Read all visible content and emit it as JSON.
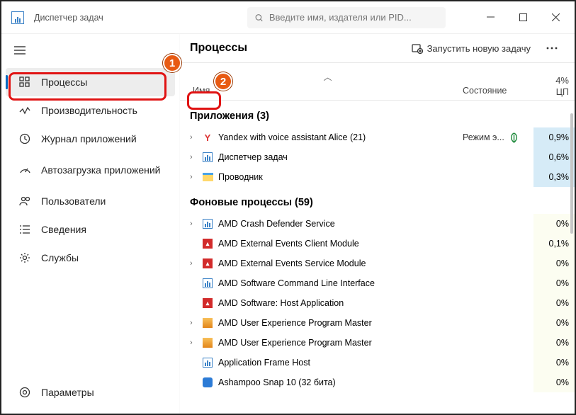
{
  "app": {
    "title": "Диспетчер задач"
  },
  "search": {
    "placeholder": "Введите имя, издателя или PID..."
  },
  "sidebar": {
    "items": [
      {
        "label": "Процессы"
      },
      {
        "label": "Производительность"
      },
      {
        "label": "Журнал приложений"
      },
      {
        "label": "Автозагрузка приложений"
      },
      {
        "label": "Пользователи"
      },
      {
        "label": "Сведения"
      },
      {
        "label": "Службы"
      }
    ],
    "settings": "Параметры"
  },
  "main": {
    "title": "Процессы",
    "run_task": "Запустить новую задачу",
    "columns": {
      "name": "Имя",
      "state": "Состояние",
      "cpu_pct": "4%",
      "cpu_label": "ЦП"
    },
    "groups": {
      "apps": {
        "title": "Приложения (3)",
        "rows": [
          {
            "name": "Yandex with voice assistant Alice (21)",
            "state": "Режим э...",
            "cpu": "0,9%",
            "icon": "y"
          },
          {
            "name": "Диспетчер задач",
            "state": "",
            "cpu": "0,6%",
            "icon": "tm"
          },
          {
            "name": "Проводник",
            "state": "",
            "cpu": "0,3%",
            "icon": "folder"
          }
        ]
      },
      "bg": {
        "title": "Фоновые процессы (59)",
        "rows": [
          {
            "name": "AMD Crash Defender Service",
            "cpu": "0%",
            "icon": "amd-b",
            "exp": true
          },
          {
            "name": "AMD External Events Client Module",
            "cpu": "0,1%",
            "icon": "amd-r"
          },
          {
            "name": "AMD External Events Service Module",
            "cpu": "0%",
            "icon": "amd-r",
            "exp": true
          },
          {
            "name": "AMD Software Command Line Interface",
            "cpu": "0%",
            "icon": "amd-b"
          },
          {
            "name": "AMD Software: Host Application",
            "cpu": "0%",
            "icon": "amd-r"
          },
          {
            "name": "AMD User Experience Program Master",
            "cpu": "0%",
            "icon": "pkg",
            "exp": true
          },
          {
            "name": "AMD User Experience Program Master",
            "cpu": "0%",
            "icon": "pkg",
            "exp": true
          },
          {
            "name": "Application Frame Host",
            "cpu": "0%",
            "icon": "amd-b"
          },
          {
            "name": "Ashampoo Snap 10 (32 бита)",
            "cpu": "0%",
            "icon": "ash"
          }
        ]
      }
    }
  }
}
